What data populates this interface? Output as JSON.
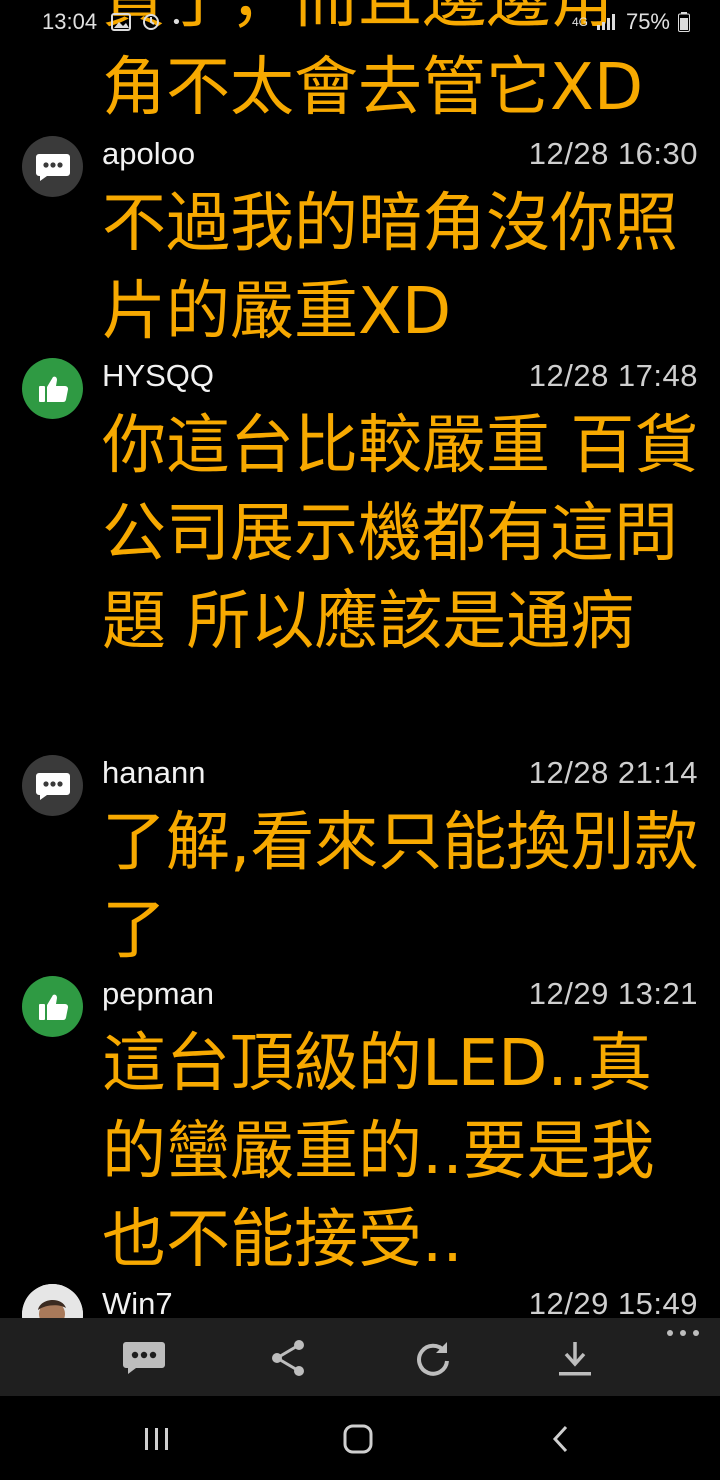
{
  "status_bar": {
    "time": "13:04",
    "battery": "75%",
    "network": "4G"
  },
  "partial_comment": {
    "line1": "貨了，而且邊邊角",
    "line2": "角不太會去管它XD"
  },
  "comments": [
    {
      "user": "apoloo",
      "time": "12/28 16:30",
      "icon": "comment-icon",
      "text": "不過我的暗角沒你照片的嚴重XD"
    },
    {
      "user": "HYSQQ",
      "time": "12/28 17:48",
      "icon": "thumbs-up-icon",
      "text": "你這台比較嚴重 百貨公司展示機都有這問題 所以應該是通病"
    },
    {
      "user": "hanann",
      "time": "12/28 21:14",
      "icon": "comment-icon",
      "text": "了解,看來只能換別款了"
    },
    {
      "user": "pepman",
      "time": "12/29 13:21",
      "icon": "thumbs-up-icon",
      "text": "這台頂級的LED..真的蠻嚴重的..要是我也不能接受.."
    },
    {
      "user": "Win7",
      "time": "12/29 15:49",
      "icon": "user-photo",
      "text": ""
    }
  ],
  "toolbar": {
    "items": [
      "comment-icon",
      "share-icon",
      "refresh-icon",
      "download-icon",
      "more-icon"
    ]
  },
  "nav": {
    "items": [
      "recent-apps-icon",
      "home-icon",
      "back-icon"
    ]
  },
  "colors": {
    "text_accent": "#f7a900",
    "thumb_green": "#2f9a43",
    "avatar_gray": "#3a3a3a",
    "toolbar_bg": "#1f1f1f"
  }
}
